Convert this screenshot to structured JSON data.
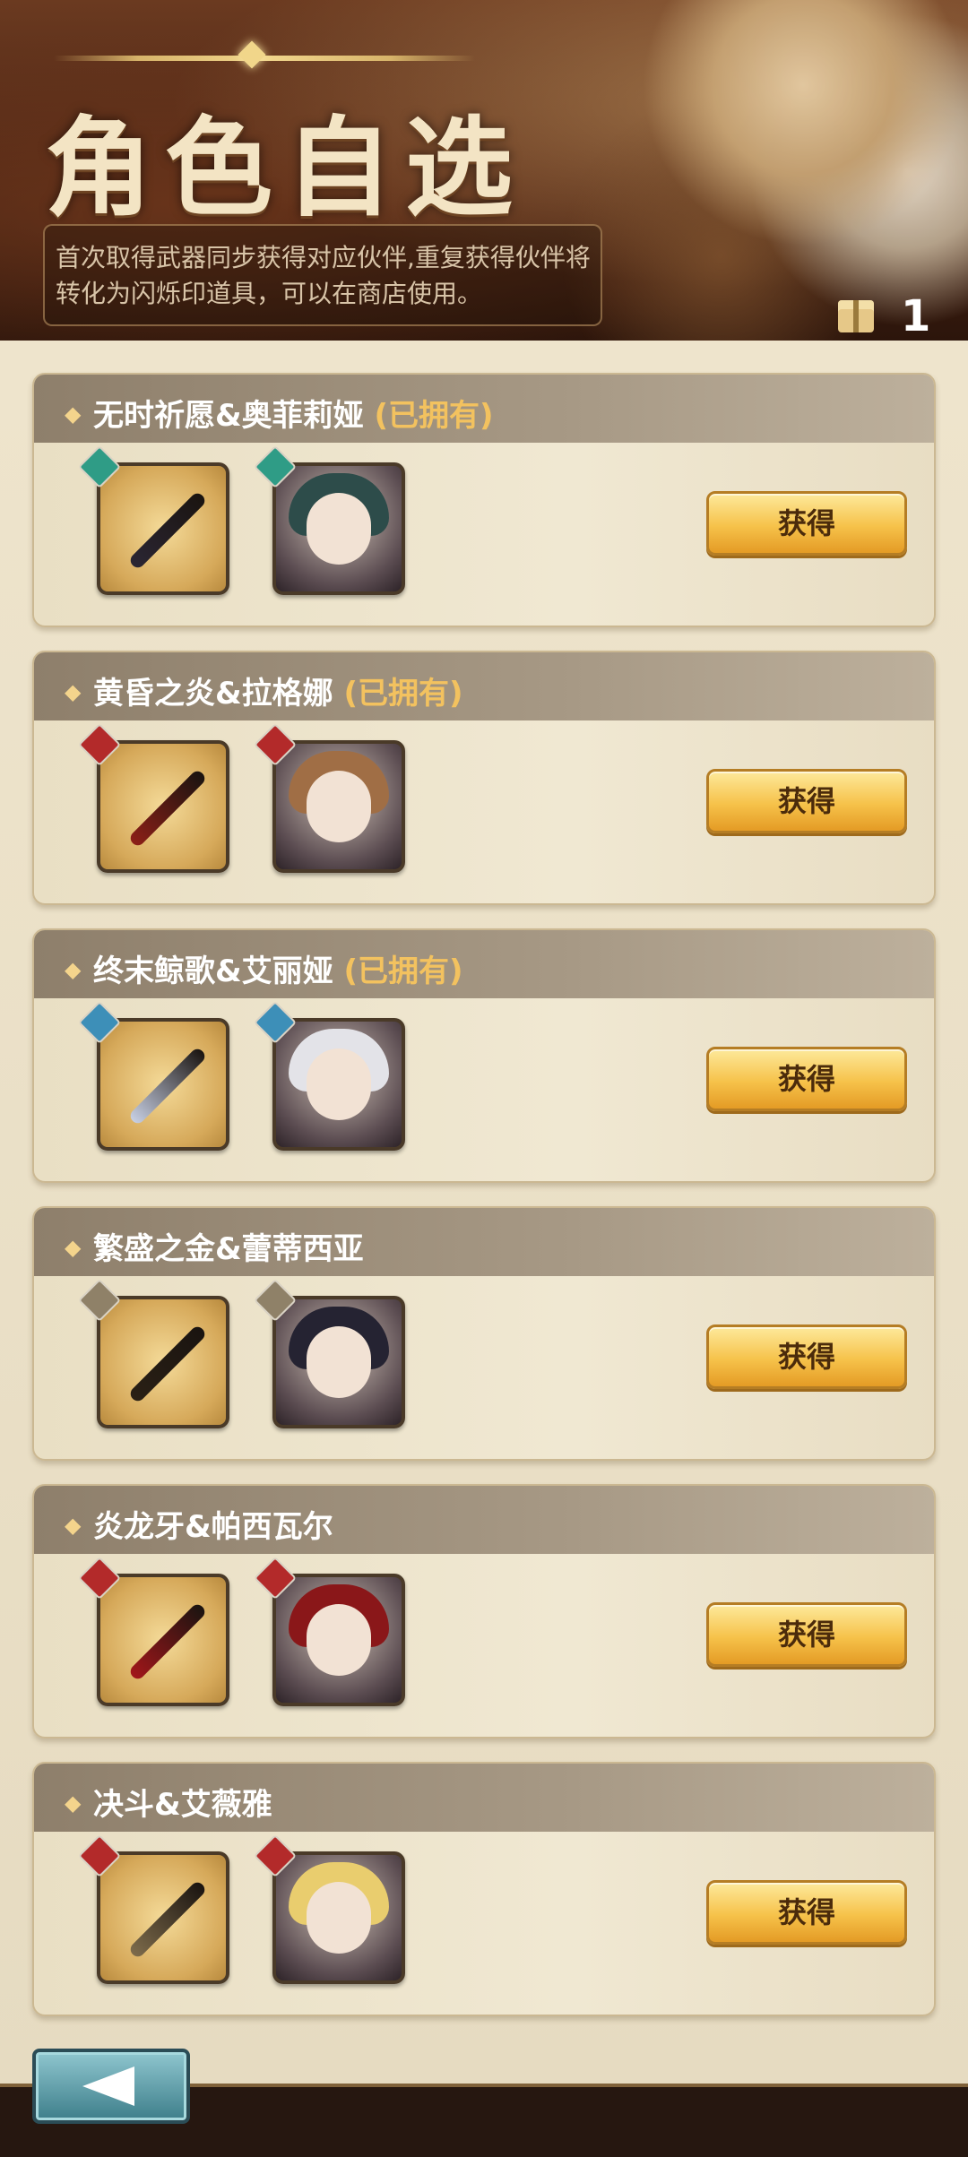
{
  "header": {
    "title": "角色自选",
    "description": "首次取得武器同步获得对应伙伴,重复获得伙伴将转化为闪烁印道具，可以在商店使用。",
    "gift_count": "1"
  },
  "items": [
    {
      "name": "无时祈愿&奥菲莉娅",
      "owned": "(已拥有)",
      "element_color": "#2f9c86",
      "weapon_color": "#2b2633",
      "hair_color": "#2d4c4a",
      "button": "获得"
    },
    {
      "name": "黄昏之炎&拉格娜",
      "owned": "(已拥有)",
      "element_color": "#b32a2a",
      "weapon_color": "#8c1f17",
      "hair_color": "#a06e45",
      "button": "获得"
    },
    {
      "name": "终末鲸歌&艾丽娅",
      "owned": "(已拥有)",
      "element_color": "#3d8fb8",
      "weapon_color": "#c7cfe3",
      "hair_color": "#e3e3e8",
      "button": "获得"
    },
    {
      "name": "繁盛之金&蕾蒂西亚",
      "owned": "",
      "element_color": "#8f8168",
      "weapon_color": "#2a2015",
      "hair_color": "#252332",
      "button": "获得"
    },
    {
      "name": "炎龙牙&帕西瓦尔",
      "owned": "",
      "element_color": "#b32a2a",
      "weapon_color": "#a2161a",
      "hair_color": "#8a1719",
      "button": "获得"
    },
    {
      "name": "决斗&艾薇雅",
      "owned": "",
      "element_color": "#b32a2a",
      "weapon_color": "#7d6b4b",
      "hair_color": "#e9cd6e",
      "button": "获得"
    }
  ]
}
